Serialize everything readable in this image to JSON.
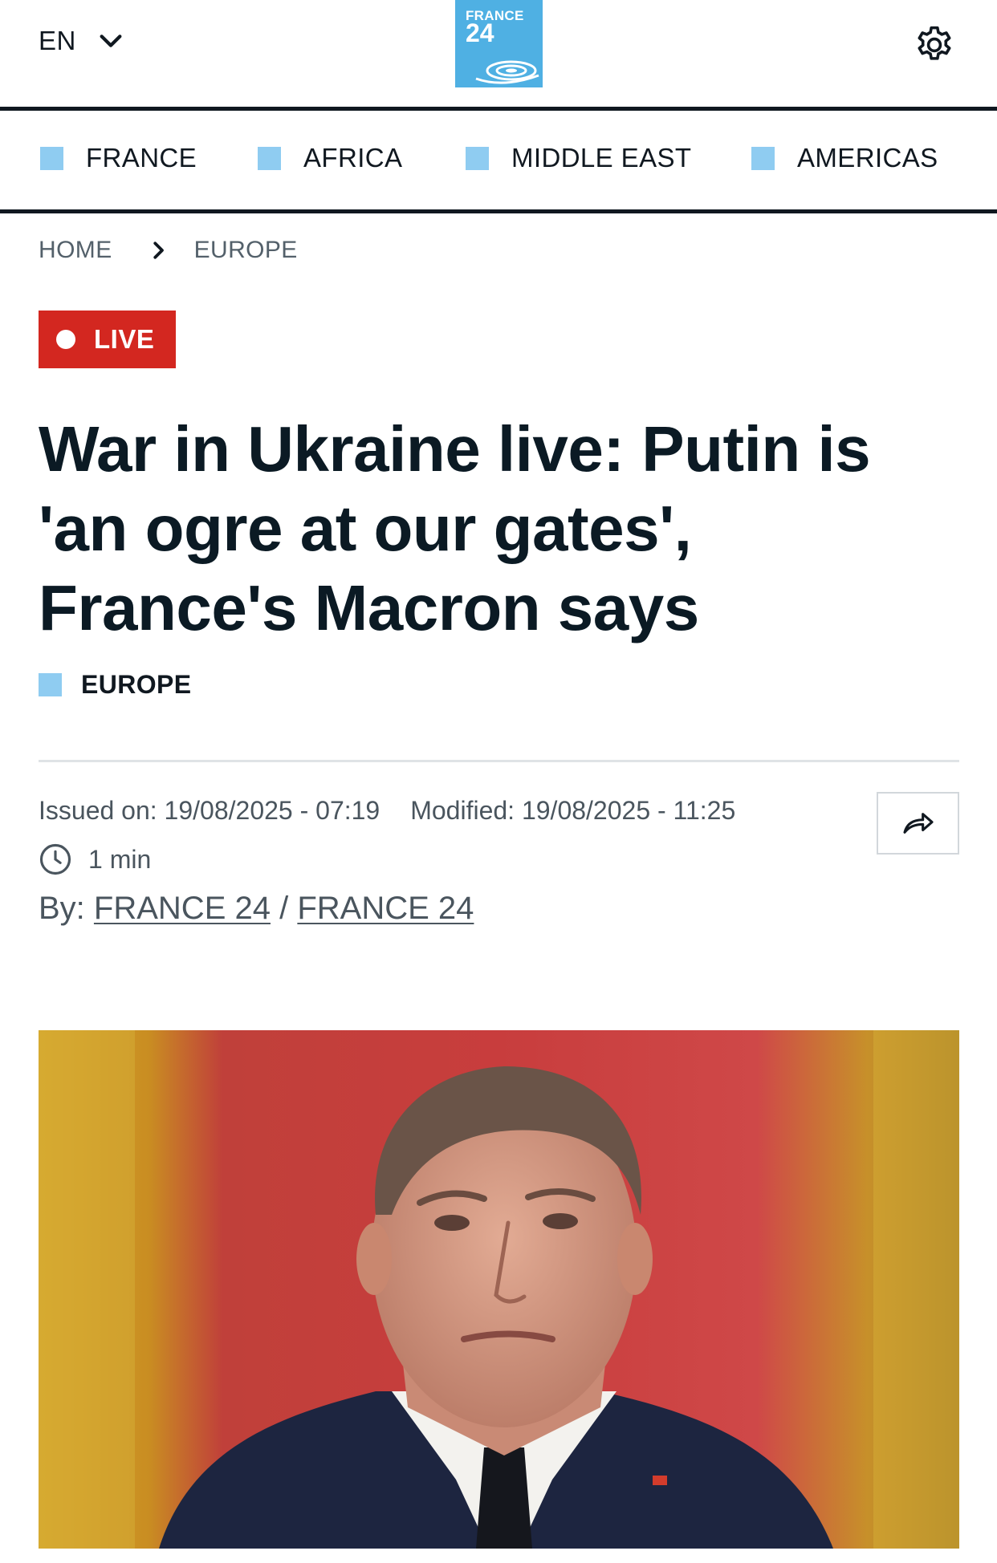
{
  "header": {
    "language": "EN",
    "logo_line1": "FRANCE",
    "logo_line2": "24"
  },
  "nav": {
    "items": [
      {
        "label": "FRANCE"
      },
      {
        "label": "AFRICA"
      },
      {
        "label": "MIDDLE EAST"
      },
      {
        "label": "AMERICAS"
      }
    ]
  },
  "breadcrumb": {
    "home": "HOME",
    "section": "EUROPE"
  },
  "article": {
    "live_label": "LIVE",
    "headline": "War in Ukraine live: Putin is 'an ogre at our gates', France's Macron says",
    "category": "EUROPE",
    "issued_on": "Issued on: 19/08/2025 - 07:19",
    "modified": "Modified: 19/08/2025 - 11:25",
    "read_time": "1 min",
    "by_prefix": "By:",
    "author_1": "FRANCE 24",
    "author_separator": "/",
    "author_2": "FRANCE 24"
  },
  "icons": {
    "language_menu": "chevron-down-icon",
    "settings": "gear-icon",
    "breadcrumb_separator": "chevron-right-icon",
    "read_time": "clock-icon",
    "share": "share-arrow-icon"
  },
  "colors": {
    "live_red": "#d32720",
    "section_blue": "#8fccf1",
    "logo_blue": "#4fb0e3",
    "text_dark": "#0b1a24",
    "meta_gray": "#4a555e"
  }
}
